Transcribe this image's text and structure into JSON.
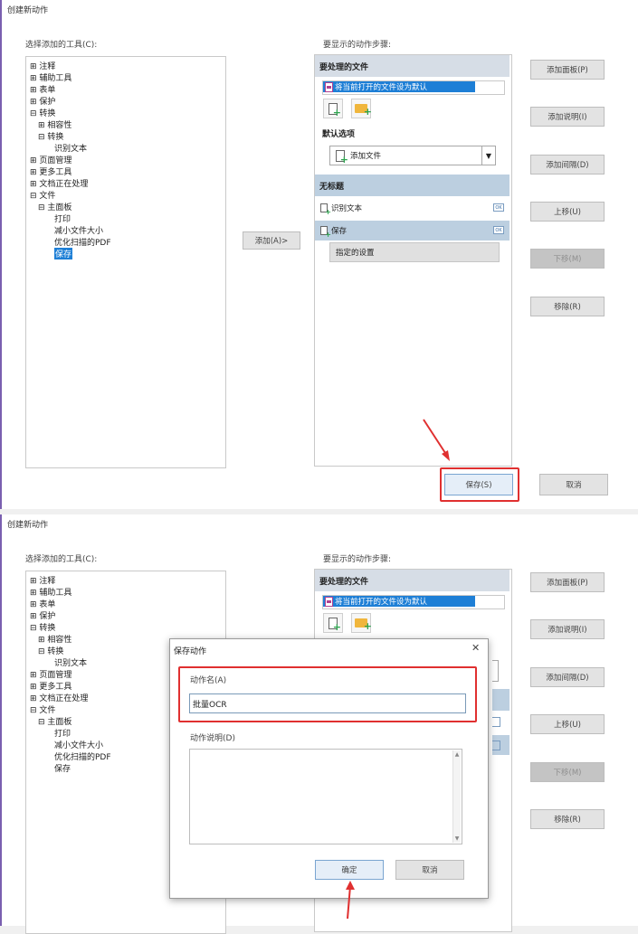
{
  "colors": {
    "accent_red": "#e03030",
    "selection_blue": "#1e7fd6",
    "window_border": "#7a5fb0"
  },
  "window1": {
    "title": "创建新动作",
    "tools_label": "选择添加的工具(C):",
    "steps_label": "要显示的动作步骤:",
    "tree": [
      {
        "text": "⊞ 注释"
      },
      {
        "text": "⊞ 辅助工具"
      },
      {
        "text": "⊞ 表单"
      },
      {
        "text": "⊞ 保护"
      },
      {
        "text": "⊟ 转换"
      },
      {
        "text": "⊞ 相容性"
      },
      {
        "text": "⊟ 转换"
      },
      {
        "text": "识别文本"
      },
      {
        "text": "⊞ 页面管理"
      },
      {
        "text": "⊞ 更多工具"
      },
      {
        "text": "⊞ 文档正在处理"
      },
      {
        "text": "⊟ 文件"
      },
      {
        "text": "⊟ 主面板"
      },
      {
        "text": "打印"
      },
      {
        "text": "减小文件大小"
      },
      {
        "text": "优化扫描的PDF"
      },
      {
        "text": "保存"
      }
    ],
    "add_button": "添加(A)>",
    "section_files": "要处理的文件",
    "file_item": "将当前打开的文件设为默认",
    "default_options": "默认选项",
    "dropdown_value": "添加文件",
    "section_untitled": "无标题",
    "step_ocr": "识别文本",
    "step_save": "保存",
    "step_specified": "指定的设置",
    "ok_icon_text": "OK",
    "right_buttons": [
      "添加面板(P)",
      "添加说明(I)",
      "添加间隔(D)",
      "上移(U)",
      "下移(M)",
      "移除(R)"
    ],
    "save_button": "保存(S)",
    "cancel_button": "取消"
  },
  "window2": {
    "title": "创建新动作",
    "tools_label": "选择添加的工具(C):",
    "steps_label": "要显示的动作步骤:",
    "section_files": "要处理的文件",
    "file_item": "将当前打开的文件设为默认",
    "right_buttons": [
      "添加面板(P)",
      "添加说明(I)",
      "添加间隔(D)",
      "上移(U)",
      "下移(M)",
      "移除(R)"
    ]
  },
  "dialog": {
    "title": "保存动作",
    "close_glyph": "✕",
    "name_label": "动作名(A)",
    "name_value": "批量OCR",
    "desc_label": "动作说明(D)",
    "ok_button": "确定",
    "cancel_button": "取消"
  }
}
